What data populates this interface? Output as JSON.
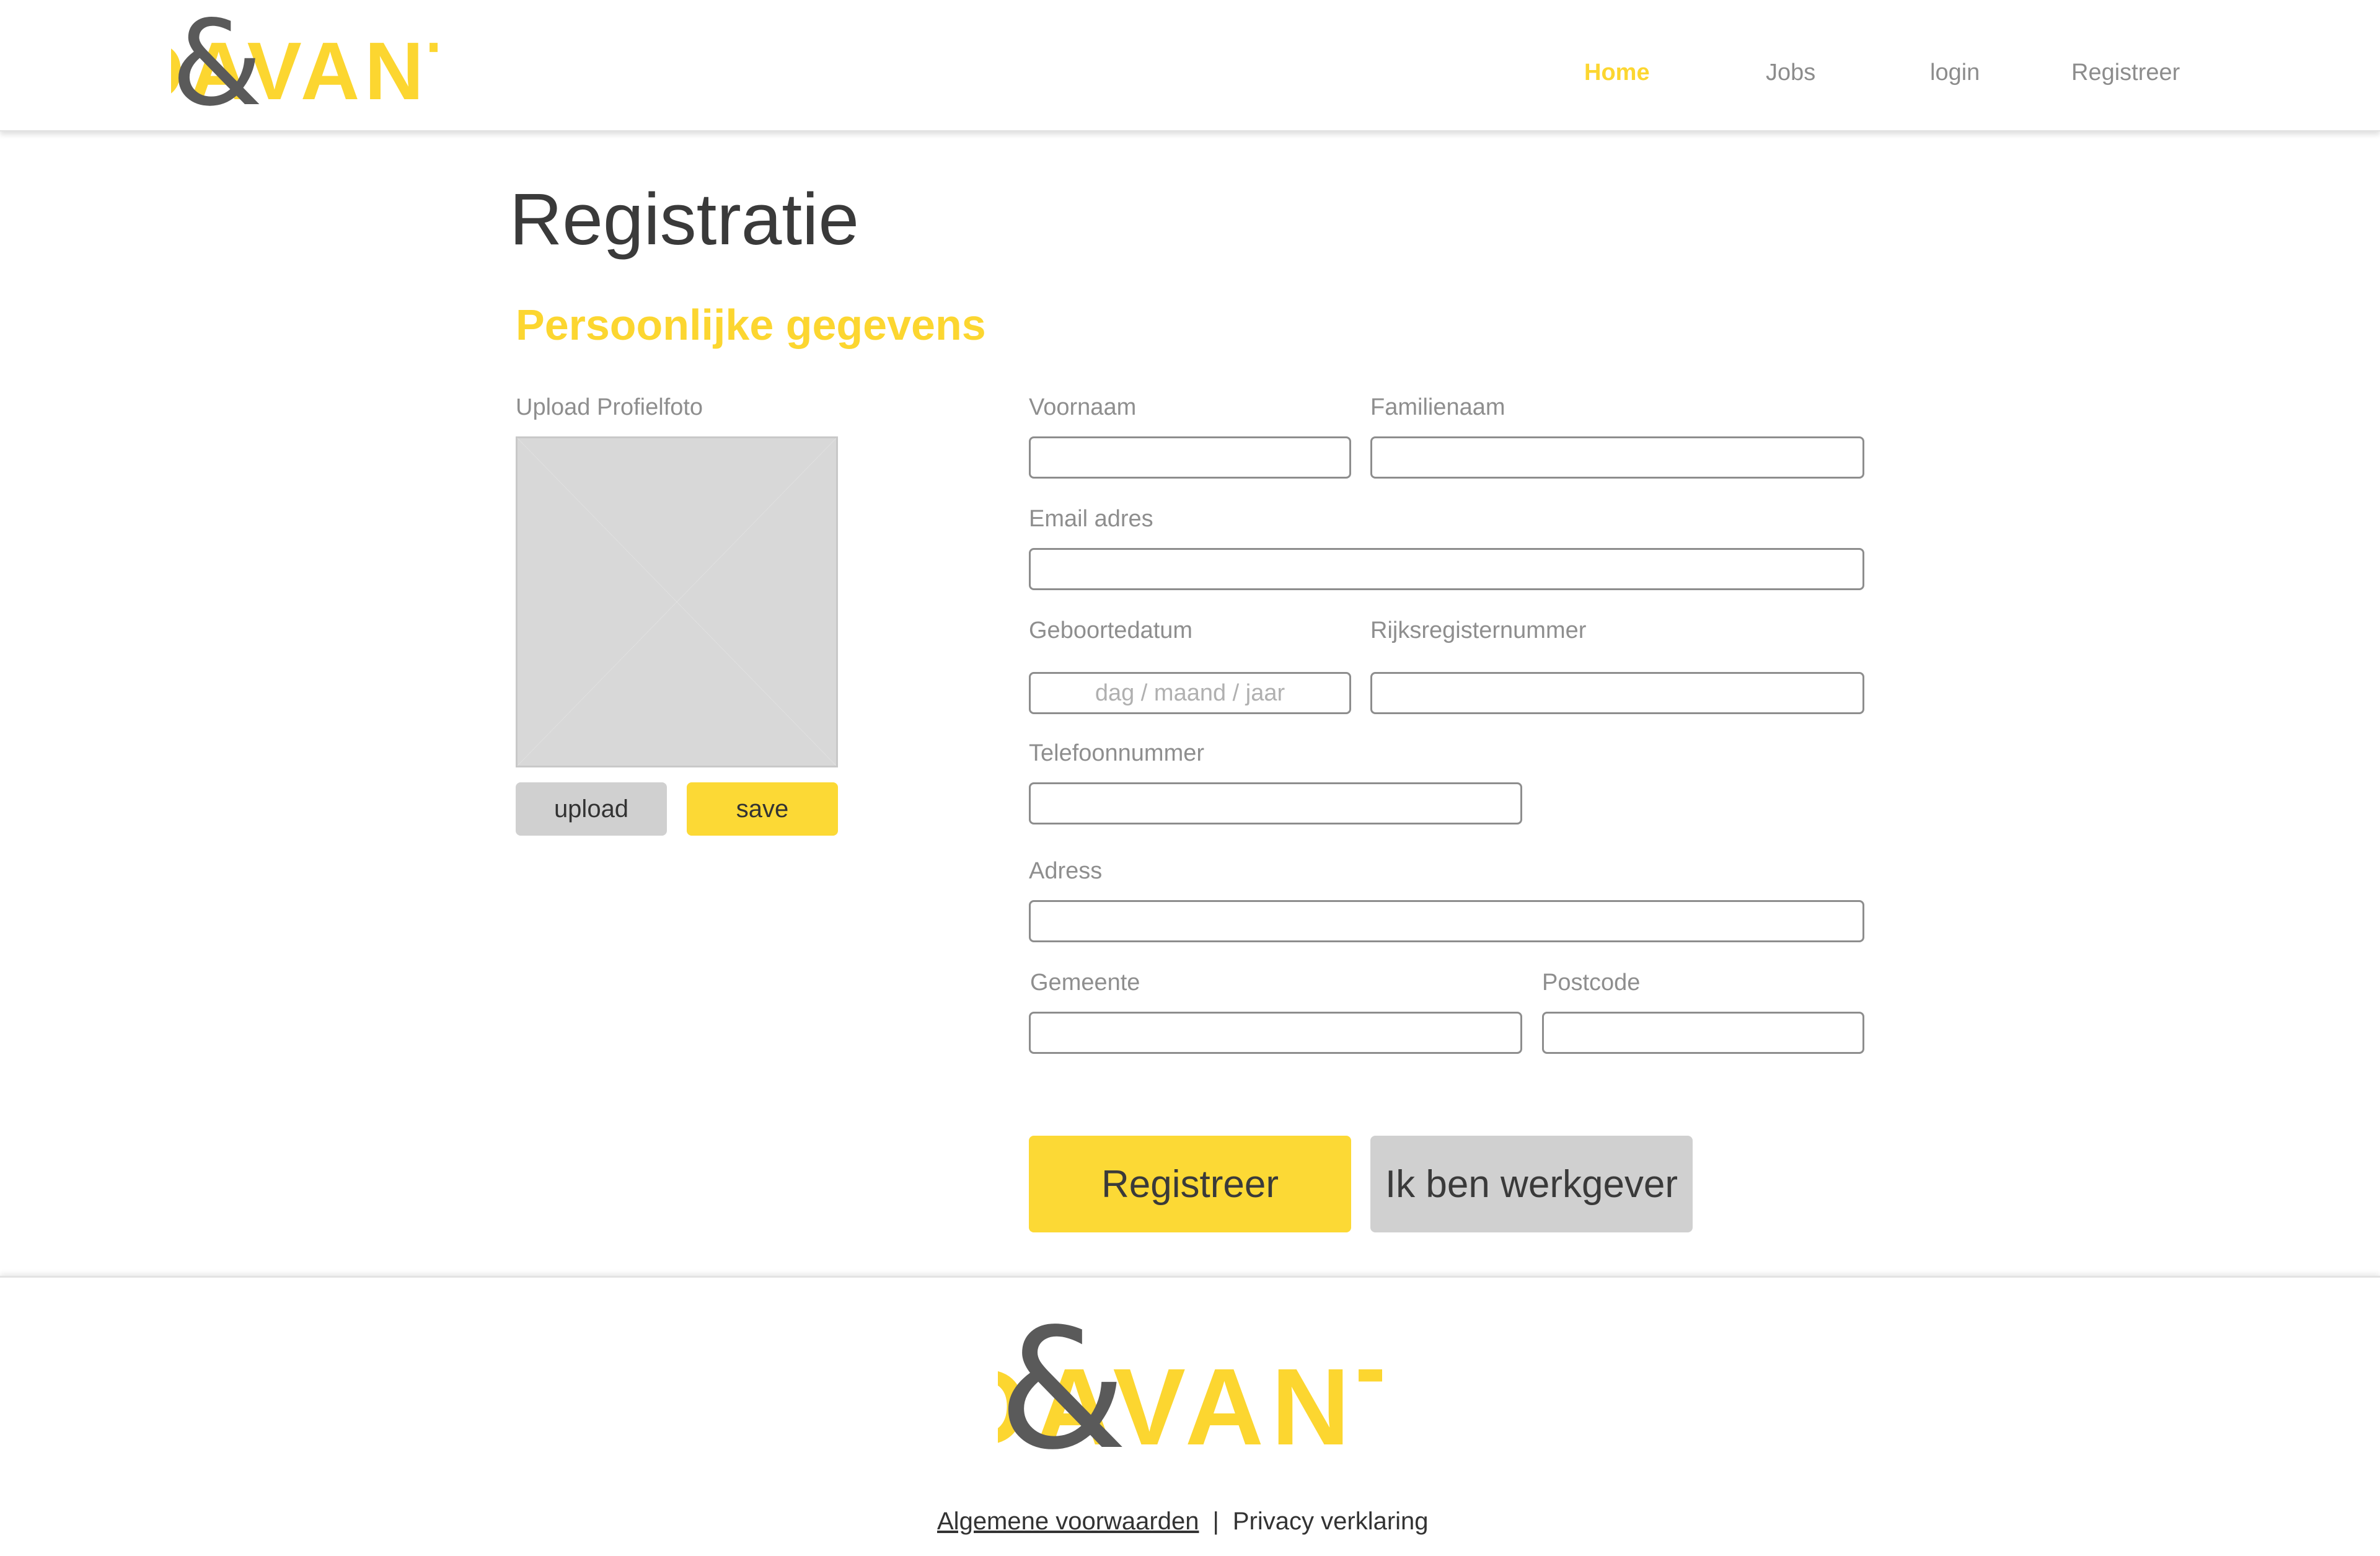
{
  "brand": {
    "name": "DAVANT",
    "symbol": "&",
    "primary_color": "#fcd630",
    "dark_color": "#5a5a5a"
  },
  "nav": {
    "items": [
      {
        "label": "Home",
        "active": true
      },
      {
        "label": "Jobs",
        "active": false
      },
      {
        "label": "login",
        "active": false
      },
      {
        "label": "Registreer",
        "active": false
      }
    ]
  },
  "page": {
    "title": "Registratie",
    "section_title": "Persoonlijke gegevens"
  },
  "photo": {
    "label": "Upload Profielfoto",
    "upload_label": "upload",
    "save_label": "save"
  },
  "form": {
    "voornaam": {
      "label": "Voornaam",
      "value": "",
      "placeholder": ""
    },
    "familienaam": {
      "label": "Familienaam",
      "value": "",
      "placeholder": ""
    },
    "email": {
      "label": "Email adres",
      "value": "",
      "placeholder": ""
    },
    "geboortedatum": {
      "label": "Geboortedatum",
      "value": "",
      "placeholder": "dag / maand / jaar"
    },
    "rijksregister": {
      "label": "Rijksregisternummer",
      "value": "",
      "placeholder": ""
    },
    "telefoon": {
      "label": "Telefoonnummer",
      "value": "",
      "placeholder": ""
    },
    "adress": {
      "label": "Adress",
      "value": "",
      "placeholder": ""
    },
    "gemeente": {
      "label": "Gemeente",
      "value": "",
      "placeholder": ""
    },
    "postcode": {
      "label": "Postcode",
      "value": "",
      "placeholder": ""
    }
  },
  "actions": {
    "register_label": "Registreer",
    "employer_label": "Ik ben werkgever"
  },
  "footer": {
    "terms_label": "Algemene voorwaarden",
    "separator": "|",
    "privacy_label": "Privacy verklaring"
  }
}
